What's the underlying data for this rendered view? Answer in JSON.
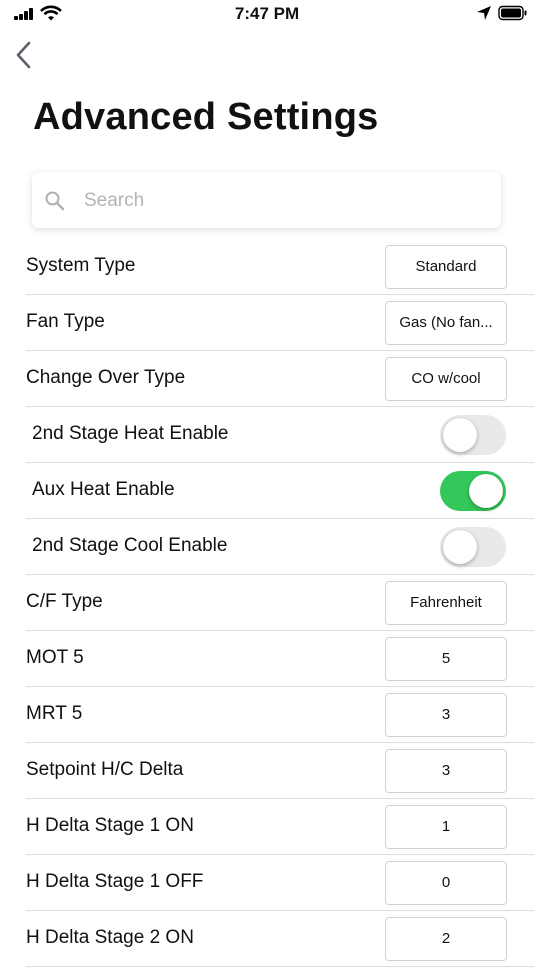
{
  "status_bar": {
    "time": "7:47 PM"
  },
  "header": {
    "title": "Advanced Settings"
  },
  "search": {
    "placeholder": "Search",
    "value": ""
  },
  "settings": [
    {
      "label": "System Type",
      "value": "Standard"
    },
    {
      "label": "Fan Type",
      "value": "Gas (No fan..."
    },
    {
      "label": "Change Over Type",
      "value": "CO w/cool"
    },
    {
      "label": "2nd Stage Heat Enable",
      "toggle": false
    },
    {
      "label": "Aux Heat Enable",
      "toggle": true
    },
    {
      "label": "2nd Stage Cool Enable",
      "toggle": false
    },
    {
      "label": "C/F Type",
      "value": "Fahrenheit"
    },
    {
      "label": "MOT 5",
      "value": "5"
    },
    {
      "label": "MRT 5",
      "value": "3"
    },
    {
      "label": "Setpoint H/C Delta",
      "value": "3"
    },
    {
      "label": "H Delta Stage 1 ON",
      "value": "1"
    },
    {
      "label": "H Delta Stage 1 OFF",
      "value": "0"
    },
    {
      "label": "H Delta Stage 2 ON",
      "value": "2"
    }
  ],
  "colors": {
    "toggle_on": "#34c759",
    "toggle_off": "#e9e9ea",
    "divider": "#dcdcdc"
  }
}
